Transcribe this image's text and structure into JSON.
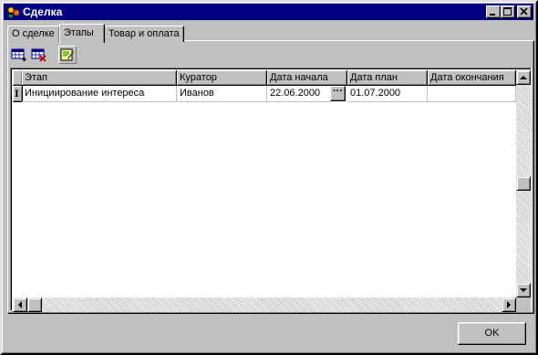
{
  "window": {
    "title": "Сделка"
  },
  "tabs": [
    {
      "label": "О сделке"
    },
    {
      "label": "Этапы"
    },
    {
      "label": "Товар и оплата"
    }
  ],
  "toolbar": {
    "add_icon": "add-row-icon",
    "delete_icon": "delete-row-icon",
    "edit_icon": "edit-document-icon"
  },
  "grid": {
    "columns": [
      "Этап",
      "Куратор",
      "Дата начала",
      "Дата план",
      "Дата окончания"
    ],
    "rows": [
      [
        "Инициирование интереса",
        "Иванов",
        "22.06.2000",
        "01.07.2000",
        ""
      ]
    ],
    "current_row_marker": "I",
    "ellipsis": "···"
  },
  "footer": {
    "ok_label": "OK"
  },
  "colors": {
    "title_bar": "#000080",
    "face": "#c0c0c0"
  }
}
